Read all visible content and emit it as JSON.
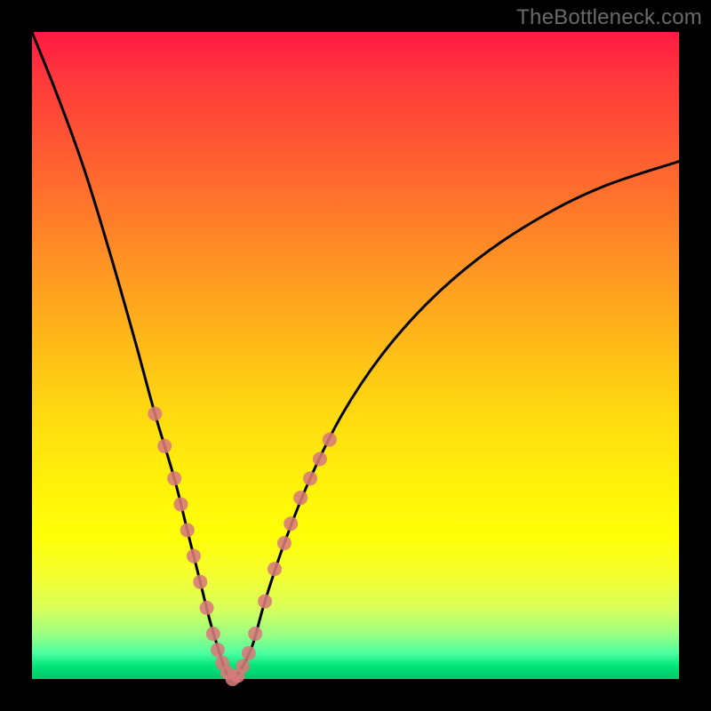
{
  "watermark": "TheBottleneck.com",
  "chart_data": {
    "type": "line",
    "title": "",
    "xlabel": "",
    "ylabel": "",
    "xlim": [
      0,
      100
    ],
    "ylim": [
      0,
      100
    ],
    "grid": false,
    "legend": false,
    "series": [
      {
        "name": "bottleneck-curve",
        "color": "#000000",
        "x": [
          0,
          4,
          8,
          12,
          16,
          19,
          22,
          24,
          26,
          27.5,
          29,
          30,
          31,
          32,
          34,
          36,
          39,
          43,
          48,
          54,
          61,
          69,
          78,
          88,
          100
        ],
        "y": [
          100,
          90,
          79,
          66,
          52,
          41,
          31,
          23,
          15,
          9,
          4,
          1,
          0,
          1,
          5,
          12,
          21,
          31,
          41,
          50,
          58,
          65,
          71,
          76,
          80
        ]
      }
    ],
    "markers": {
      "name": "highlight-dots",
      "color": "#d87a7a",
      "radius": 8,
      "points": [
        {
          "x": 19.0,
          "y": 41
        },
        {
          "x": 20.5,
          "y": 36
        },
        {
          "x": 22.0,
          "y": 31
        },
        {
          "x": 23.0,
          "y": 27
        },
        {
          "x": 24.0,
          "y": 23
        },
        {
          "x": 25.0,
          "y": 19
        },
        {
          "x": 26.0,
          "y": 15
        },
        {
          "x": 27.0,
          "y": 11
        },
        {
          "x": 28.0,
          "y": 7
        },
        {
          "x": 28.7,
          "y": 4.5
        },
        {
          "x": 29.4,
          "y": 2.5
        },
        {
          "x": 30.2,
          "y": 1
        },
        {
          "x": 31.0,
          "y": 0
        },
        {
          "x": 31.8,
          "y": 0.5
        },
        {
          "x": 32.6,
          "y": 2
        },
        {
          "x": 33.5,
          "y": 4
        },
        {
          "x": 34.5,
          "y": 7
        },
        {
          "x": 36.0,
          "y": 12
        },
        {
          "x": 37.5,
          "y": 17
        },
        {
          "x": 39.0,
          "y": 21
        },
        {
          "x": 40.0,
          "y": 24
        },
        {
          "x": 41.5,
          "y": 28
        },
        {
          "x": 43.0,
          "y": 31
        },
        {
          "x": 44.5,
          "y": 34
        },
        {
          "x": 46.0,
          "y": 37
        }
      ]
    }
  }
}
